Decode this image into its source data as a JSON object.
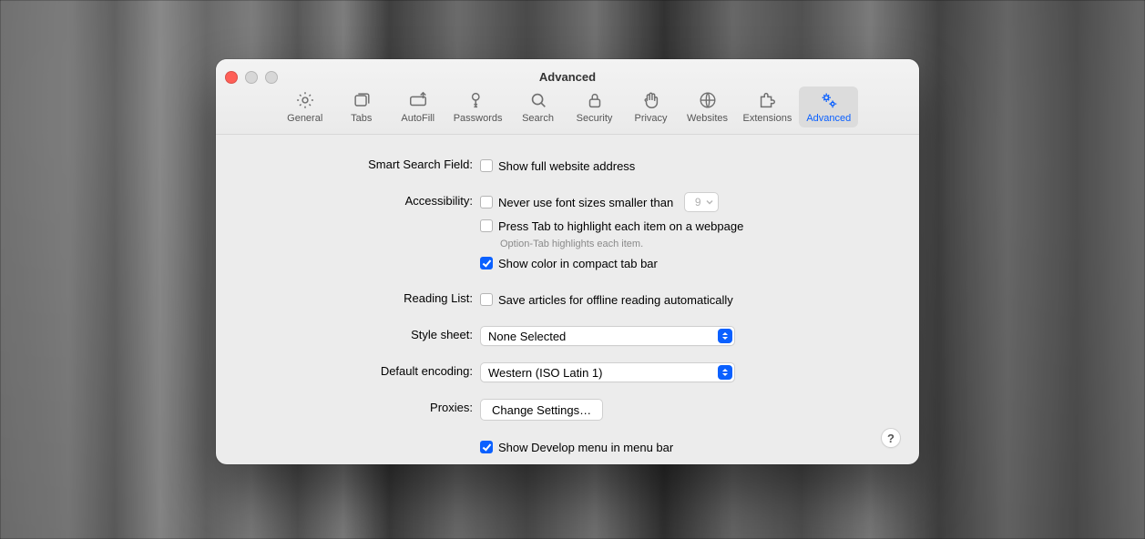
{
  "window": {
    "title": "Advanced"
  },
  "tabs": [
    {
      "label": "General"
    },
    {
      "label": "Tabs"
    },
    {
      "label": "AutoFill"
    },
    {
      "label": "Passwords"
    },
    {
      "label": "Search"
    },
    {
      "label": "Security"
    },
    {
      "label": "Privacy"
    },
    {
      "label": "Websites"
    },
    {
      "label": "Extensions"
    },
    {
      "label": "Advanced"
    }
  ],
  "labels": {
    "smart_search": "Smart Search Field:",
    "accessibility": "Accessibility:",
    "reading_list": "Reading List:",
    "style_sheet": "Style sheet:",
    "default_encoding": "Default encoding:",
    "proxies": "Proxies:"
  },
  "options": {
    "show_full_address": "Show full website address",
    "never_font_smaller": "Never use font sizes smaller than",
    "font_size_value": "9",
    "press_tab": "Press Tab to highlight each item on a webpage",
    "press_tab_hint": "Option-Tab highlights each item.",
    "show_color_tab_bar": "Show color in compact tab bar",
    "save_offline": "Save articles for offline reading automatically",
    "style_sheet_value": "None Selected",
    "default_encoding_value": "Western (ISO Latin 1)",
    "proxies_button": "Change Settings…",
    "show_develop": "Show Develop menu in menu bar"
  },
  "checked": {
    "show_full_address": false,
    "never_font_smaller": false,
    "press_tab": false,
    "show_color_tab_bar": true,
    "save_offline": false,
    "show_develop": true
  },
  "help": "?"
}
